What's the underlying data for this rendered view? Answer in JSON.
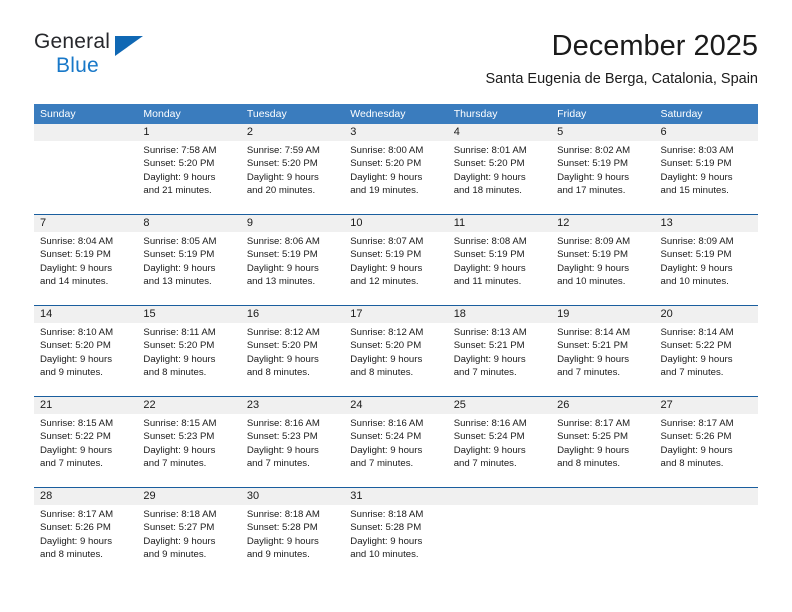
{
  "brand": {
    "name_part1": "General",
    "name_part2": "Blue",
    "triangle_color": "#1068b4",
    "blue_color": "#1878c8"
  },
  "header": {
    "title": "December 2025",
    "subtitle": "Santa Eugenia de Berga, Catalonia, Spain"
  },
  "theme": {
    "header_row_bg": "#3a7cbe",
    "week_separator": "#1a5e9e",
    "day_number_bg": "#f0f0f0",
    "text": "#1b1b1b"
  },
  "calendar": {
    "day_headers": [
      "Sunday",
      "Monday",
      "Tuesday",
      "Wednesday",
      "Thursday",
      "Friday",
      "Saturday"
    ],
    "weeks": [
      [
        {
          "day": "",
          "lines": []
        },
        {
          "day": "1",
          "lines": [
            "Sunrise: 7:58 AM",
            "Sunset: 5:20 PM",
            "Daylight: 9 hours",
            "and 21 minutes."
          ]
        },
        {
          "day": "2",
          "lines": [
            "Sunrise: 7:59 AM",
            "Sunset: 5:20 PM",
            "Daylight: 9 hours",
            "and 20 minutes."
          ]
        },
        {
          "day": "3",
          "lines": [
            "Sunrise: 8:00 AM",
            "Sunset: 5:20 PM",
            "Daylight: 9 hours",
            "and 19 minutes."
          ]
        },
        {
          "day": "4",
          "lines": [
            "Sunrise: 8:01 AM",
            "Sunset: 5:20 PM",
            "Daylight: 9 hours",
            "and 18 minutes."
          ]
        },
        {
          "day": "5",
          "lines": [
            "Sunrise: 8:02 AM",
            "Sunset: 5:19 PM",
            "Daylight: 9 hours",
            "and 17 minutes."
          ]
        },
        {
          "day": "6",
          "lines": [
            "Sunrise: 8:03 AM",
            "Sunset: 5:19 PM",
            "Daylight: 9 hours",
            "and 15 minutes."
          ]
        }
      ],
      [
        {
          "day": "7",
          "lines": [
            "Sunrise: 8:04 AM",
            "Sunset: 5:19 PM",
            "Daylight: 9 hours",
            "and 14 minutes."
          ]
        },
        {
          "day": "8",
          "lines": [
            "Sunrise: 8:05 AM",
            "Sunset: 5:19 PM",
            "Daylight: 9 hours",
            "and 13 minutes."
          ]
        },
        {
          "day": "9",
          "lines": [
            "Sunrise: 8:06 AM",
            "Sunset: 5:19 PM",
            "Daylight: 9 hours",
            "and 13 minutes."
          ]
        },
        {
          "day": "10",
          "lines": [
            "Sunrise: 8:07 AM",
            "Sunset: 5:19 PM",
            "Daylight: 9 hours",
            "and 12 minutes."
          ]
        },
        {
          "day": "11",
          "lines": [
            "Sunrise: 8:08 AM",
            "Sunset: 5:19 PM",
            "Daylight: 9 hours",
            "and 11 minutes."
          ]
        },
        {
          "day": "12",
          "lines": [
            "Sunrise: 8:09 AM",
            "Sunset: 5:19 PM",
            "Daylight: 9 hours",
            "and 10 minutes."
          ]
        },
        {
          "day": "13",
          "lines": [
            "Sunrise: 8:09 AM",
            "Sunset: 5:19 PM",
            "Daylight: 9 hours",
            "and 10 minutes."
          ]
        }
      ],
      [
        {
          "day": "14",
          "lines": [
            "Sunrise: 8:10 AM",
            "Sunset: 5:20 PM",
            "Daylight: 9 hours",
            "and 9 minutes."
          ]
        },
        {
          "day": "15",
          "lines": [
            "Sunrise: 8:11 AM",
            "Sunset: 5:20 PM",
            "Daylight: 9 hours",
            "and 8 minutes."
          ]
        },
        {
          "day": "16",
          "lines": [
            "Sunrise: 8:12 AM",
            "Sunset: 5:20 PM",
            "Daylight: 9 hours",
            "and 8 minutes."
          ]
        },
        {
          "day": "17",
          "lines": [
            "Sunrise: 8:12 AM",
            "Sunset: 5:20 PM",
            "Daylight: 9 hours",
            "and 8 minutes."
          ]
        },
        {
          "day": "18",
          "lines": [
            "Sunrise: 8:13 AM",
            "Sunset: 5:21 PM",
            "Daylight: 9 hours",
            "and 7 minutes."
          ]
        },
        {
          "day": "19",
          "lines": [
            "Sunrise: 8:14 AM",
            "Sunset: 5:21 PM",
            "Daylight: 9 hours",
            "and 7 minutes."
          ]
        },
        {
          "day": "20",
          "lines": [
            "Sunrise: 8:14 AM",
            "Sunset: 5:22 PM",
            "Daylight: 9 hours",
            "and 7 minutes."
          ]
        }
      ],
      [
        {
          "day": "21",
          "lines": [
            "Sunrise: 8:15 AM",
            "Sunset: 5:22 PM",
            "Daylight: 9 hours",
            "and 7 minutes."
          ]
        },
        {
          "day": "22",
          "lines": [
            "Sunrise: 8:15 AM",
            "Sunset: 5:23 PM",
            "Daylight: 9 hours",
            "and 7 minutes."
          ]
        },
        {
          "day": "23",
          "lines": [
            "Sunrise: 8:16 AM",
            "Sunset: 5:23 PM",
            "Daylight: 9 hours",
            "and 7 minutes."
          ]
        },
        {
          "day": "24",
          "lines": [
            "Sunrise: 8:16 AM",
            "Sunset: 5:24 PM",
            "Daylight: 9 hours",
            "and 7 minutes."
          ]
        },
        {
          "day": "25",
          "lines": [
            "Sunrise: 8:16 AM",
            "Sunset: 5:24 PM",
            "Daylight: 9 hours",
            "and 7 minutes."
          ]
        },
        {
          "day": "26",
          "lines": [
            "Sunrise: 8:17 AM",
            "Sunset: 5:25 PM",
            "Daylight: 9 hours",
            "and 8 minutes."
          ]
        },
        {
          "day": "27",
          "lines": [
            "Sunrise: 8:17 AM",
            "Sunset: 5:26 PM",
            "Daylight: 9 hours",
            "and 8 minutes."
          ]
        }
      ],
      [
        {
          "day": "28",
          "lines": [
            "Sunrise: 8:17 AM",
            "Sunset: 5:26 PM",
            "Daylight: 9 hours",
            "and 8 minutes."
          ]
        },
        {
          "day": "29",
          "lines": [
            "Sunrise: 8:18 AM",
            "Sunset: 5:27 PM",
            "Daylight: 9 hours",
            "and 9 minutes."
          ]
        },
        {
          "day": "30",
          "lines": [
            "Sunrise: 8:18 AM",
            "Sunset: 5:28 PM",
            "Daylight: 9 hours",
            "and 9 minutes."
          ]
        },
        {
          "day": "31",
          "lines": [
            "Sunrise: 8:18 AM",
            "Sunset: 5:28 PM",
            "Daylight: 9 hours",
            "and 10 minutes."
          ]
        },
        {
          "day": "",
          "lines": []
        },
        {
          "day": "",
          "lines": []
        },
        {
          "day": "",
          "lines": []
        }
      ]
    ]
  }
}
